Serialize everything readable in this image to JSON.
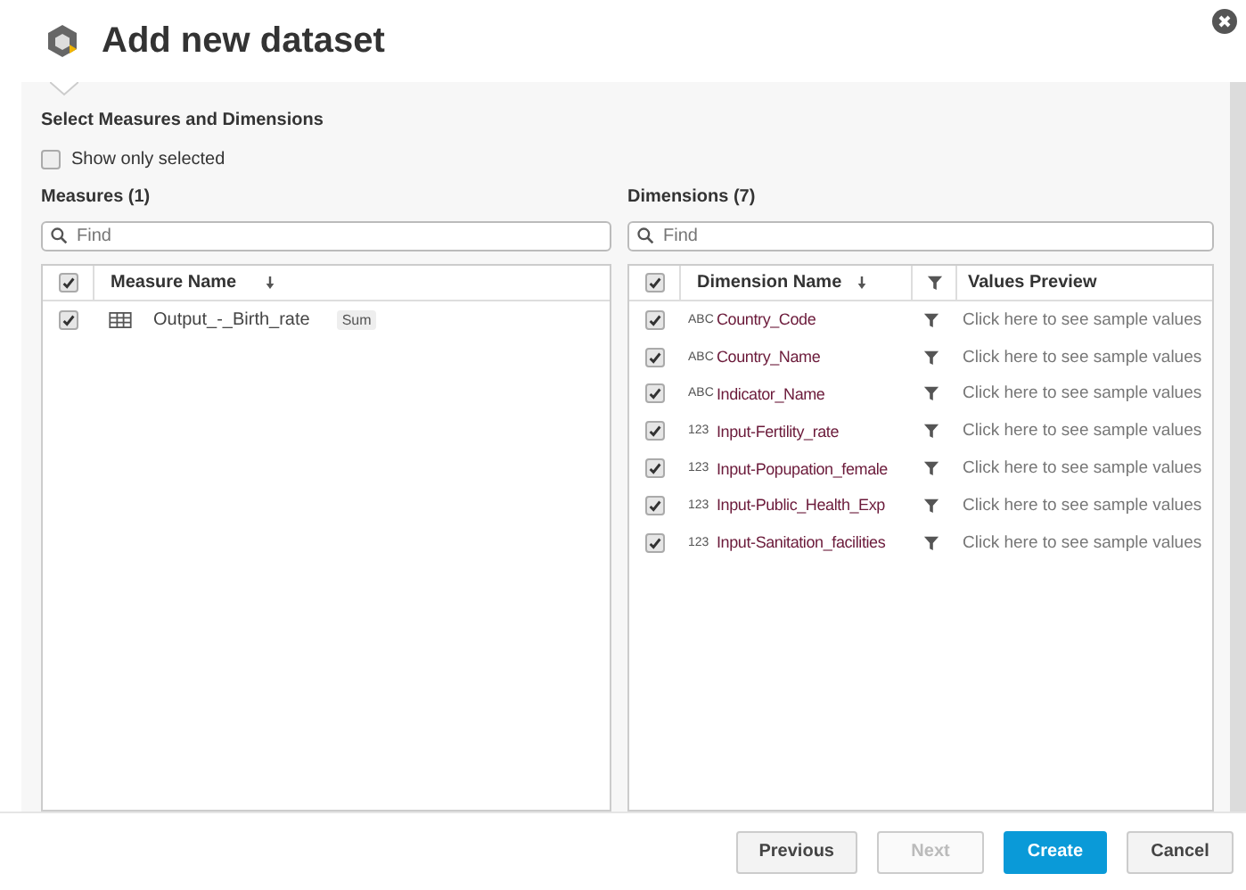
{
  "window": {
    "title": "Add new dataset"
  },
  "section_title": "Select Measures and Dimensions",
  "show_only_selected": {
    "label": "Show only selected",
    "checked": false
  },
  "measures": {
    "title": "Measures (1)",
    "search": {
      "placeholder": "Find"
    },
    "header_checked": true,
    "columns": [
      "Measure Name"
    ],
    "rows": [
      {
        "name": "Output_-_Birth_rate",
        "checked": true,
        "aggregation": "Sum"
      }
    ]
  },
  "dimensions": {
    "title": "Dimensions (7)",
    "search": {
      "placeholder": "Find"
    },
    "header_checked": true,
    "columns": [
      "Dimension Name",
      "Values Preview"
    ],
    "rows": [
      {
        "name": "Country_Code",
        "type": "ABC",
        "checked": true,
        "preview": "Click here to see sample values"
      },
      {
        "name": "Country_Name",
        "type": "ABC",
        "checked": true,
        "preview": "Click here to see sample values"
      },
      {
        "name": "Indicator_Name",
        "type": "ABC",
        "checked": true,
        "preview": "Click here to see sample values"
      },
      {
        "name": "Input-Fertility_rate",
        "type": "123",
        "checked": true,
        "preview": "Click here to see sample values"
      },
      {
        "name": "Input-Popupation_female",
        "type": "123",
        "checked": true,
        "preview": "Click here to see sample values"
      },
      {
        "name": "Input-Public_Health_Exp",
        "type": "123",
        "checked": true,
        "preview": "Click here to see sample values"
      },
      {
        "name": "Input-Sanitation_facilities",
        "type": "123",
        "checked": true,
        "preview": "Click here to see sample values"
      }
    ]
  },
  "buttons": [
    {
      "label": "Previous",
      "kind": "default",
      "disabled": false
    },
    {
      "label": "Next",
      "kind": "default",
      "disabled": true
    },
    {
      "label": "Create",
      "kind": "primary",
      "disabled": false
    },
    {
      "label": "Cancel",
      "kind": "default",
      "disabled": false
    }
  ]
}
